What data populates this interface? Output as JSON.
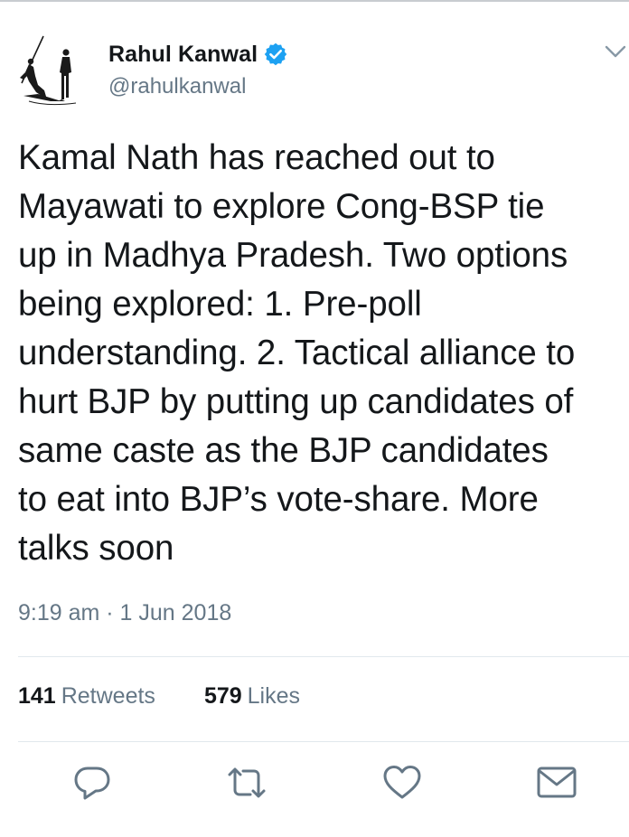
{
  "tweet": {
    "display_name": "Rahul Kanwal",
    "handle": "@rahulkanwal",
    "verified": true,
    "text": "Kamal Nath has reached out to\nMayawati to explore Cong-BSP tie\nup in Madhya Pradesh. Two options\nbeing explored: 1. Pre-poll\nunderstanding. 2. Tactical alliance to\nhurt BJP by putting up candidates of\nsame caste as the BJP candidates\nto eat into BJP’s vote-share. More\ntalks soon",
    "timestamp": "9:19 am · 1 Jun 2018"
  },
  "stats": {
    "retweets_count": "141",
    "retweets_label": "Retweets",
    "likes_count": "579",
    "likes_label": "Likes"
  },
  "actions": [
    {
      "icon": "reply-icon"
    },
    {
      "icon": "retweet-icon"
    },
    {
      "icon": "like-icon"
    },
    {
      "icon": "share-icon"
    }
  ],
  "colors": {
    "primary_text": "#14171a",
    "secondary_text": "#657786",
    "verified_blue": "#1da1f2",
    "divider": "#e1e8ed"
  }
}
